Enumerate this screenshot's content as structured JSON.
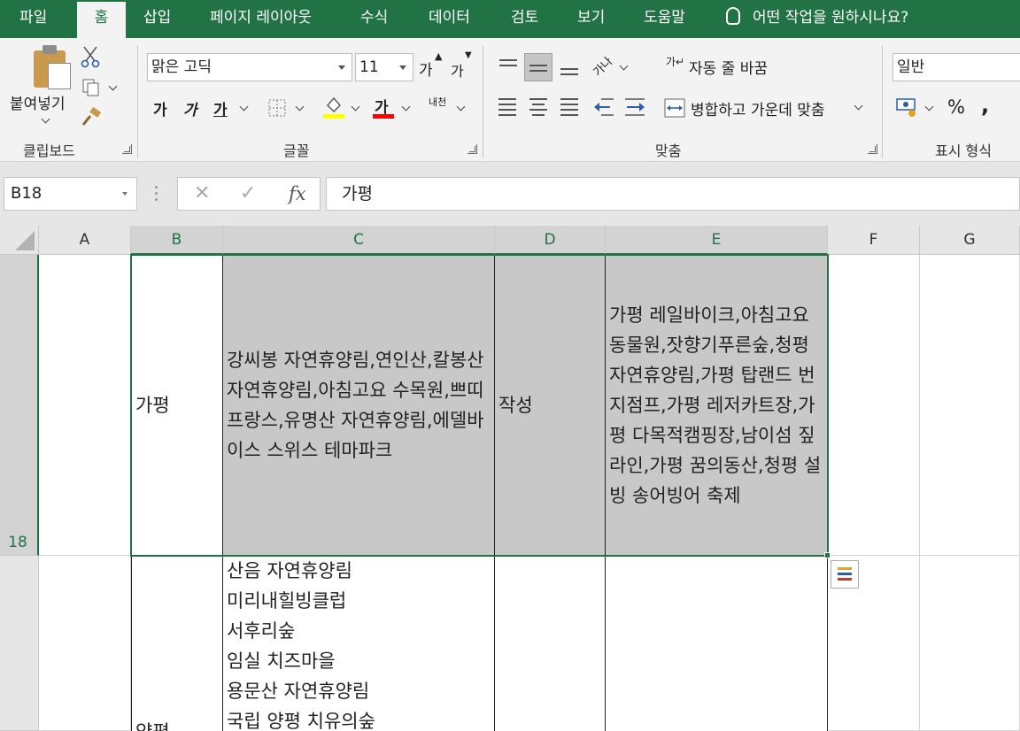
{
  "tabs": [
    {
      "label": "파일",
      "active": false
    },
    {
      "label": "홈",
      "active": true
    },
    {
      "label": "삽입",
      "active": false
    },
    {
      "label": "페이지 레이아웃",
      "active": false
    },
    {
      "label": "수식",
      "active": false
    },
    {
      "label": "데이터",
      "active": false
    },
    {
      "label": "검토",
      "active": false
    },
    {
      "label": "보기",
      "active": false
    },
    {
      "label": "도움말",
      "active": false
    }
  ],
  "tell_me": "어떤 작업을 원하시나요?",
  "ribbon": {
    "clipboard": {
      "paste_label": "붙여넣기",
      "group_label": "클립보드"
    },
    "font": {
      "font_name": "맑은 고딕",
      "font_size": "11",
      "grow_font": "가",
      "shrink_font": "가",
      "bold": "가",
      "italic": "가",
      "underline": "가",
      "font_color_glyph": "가",
      "phonetic": "내천",
      "group_label": "글꼴",
      "fill_color": "#ffff00",
      "font_color": "#ff0000"
    },
    "alignment": {
      "wrap_text": "자동 줄 바꿈",
      "merge_center": "병합하고 가운데 맞춤",
      "group_label": "맞춤",
      "orientation_glyph": "가나"
    },
    "number": {
      "format": "일반",
      "percent": "%",
      "comma": ",",
      "group_label": "표시 형식"
    }
  },
  "formula_bar": {
    "name_box": "B18",
    "cancel": "✕",
    "enter": "✓",
    "fx": "fx",
    "content": "가평"
  },
  "columns": [
    {
      "label": "A",
      "selected": false
    },
    {
      "label": "B",
      "selected": true
    },
    {
      "label": "C",
      "selected": true
    },
    {
      "label": "D",
      "selected": true
    },
    {
      "label": "E",
      "selected": true
    },
    {
      "label": "F",
      "selected": false
    },
    {
      "label": "G",
      "selected": false
    }
  ],
  "rows": [
    {
      "label": "18",
      "selected": true
    },
    {
      "label": "",
      "selected": false
    }
  ],
  "row18": {
    "B": "가평",
    "C": "강씨봉 자연휴양림,연인산,칼봉산 자연휴양림,아침고요 수목원,쁘띠프랑스,유명산 자연휴양림,에델바이스 스위스 테마파크",
    "D": "작성",
    "E": "가평 레일바이크,아침고요 동물원,잣향기푸른숲,청평자연휴양림,가평 탑랜드 번지점프,가평 레저카트장,가평 다목적캠핑장,남이섬 짚라인,가평 꿈의동산,청평 설빙 송어빙어 축제"
  },
  "row19": {
    "B": "양평",
    "C_lines": [
      "산음 자연휴양림",
      "미리내힐빙클럽",
      "서후리숲",
      "임실 치즈마을",
      "용문산 자연휴양림",
      "국립 양평 치유의숲"
    ]
  },
  "accent": "#217346"
}
